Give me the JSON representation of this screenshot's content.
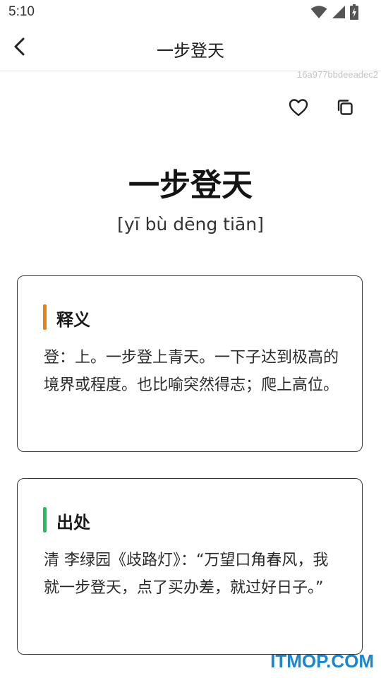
{
  "status_bar": {
    "time": "5:10",
    "icons": [
      "wifi-icon",
      "signal-icon",
      "battery-charging-icon"
    ]
  },
  "header": {
    "title": "一步登天",
    "back_icon": "chevron-left-icon"
  },
  "record_id": "16a977bbdeeadec2",
  "actions": {
    "favorite_icon": "heart-outline-icon",
    "copy_icon": "copy-icon"
  },
  "idiom": {
    "text": "一步登天",
    "pinyin": "[yī bù dēng tiān]"
  },
  "cards": [
    {
      "heading": "释义",
      "accent_color": "#ee7d1a",
      "body": "登：上。一步登上青天。一下子达到极高的境界或程度。也比喻突然得志；爬上高位。"
    },
    {
      "heading": "出处",
      "accent_color": "#22c05a",
      "body": "清 李绿园《歧路灯》：“万望口角春风，我就一步登天，点了买办差，就过好日子。”"
    }
  ],
  "watermark": "ITMOP.COM"
}
